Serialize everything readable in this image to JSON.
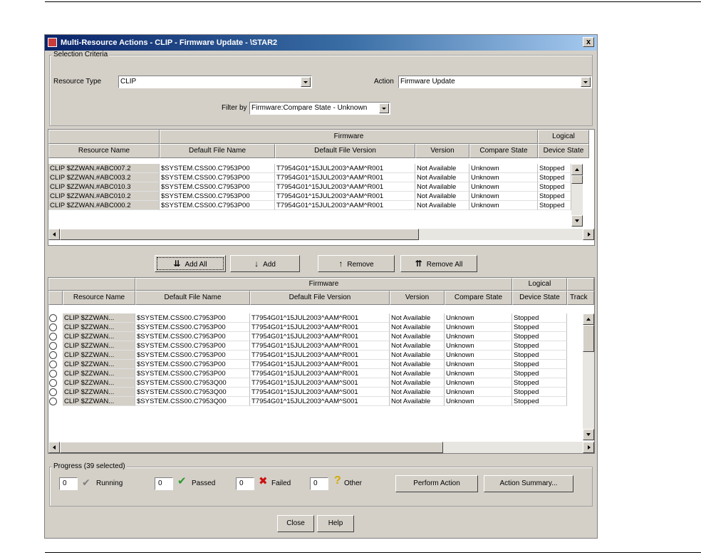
{
  "window": {
    "title": "Multi-Resource Actions - CLIP - Firmware Update - \\STAR2",
    "close_glyph": "x"
  },
  "selection": {
    "group_label": "Selection Criteria",
    "resource_type_label": "Resource Type",
    "resource_type_value": "CLIP",
    "action_label": "Action",
    "action_value": "Firmware Update",
    "filter_label": "Filter by",
    "filter_value": "Firmware:Compare State - Unknown"
  },
  "top_table": {
    "group_headers": [
      "Firmware",
      "Logical"
    ],
    "columns": [
      "Resource Name",
      "Default File Name",
      "Default File Version",
      "Version",
      "Compare State",
      "Device State"
    ],
    "rows": [
      [
        "CLIP $ZZWAN.#ABC007.2",
        "$SYSTEM.CSS00.C7953P00",
        "T7954G01^15JUL2003^AAM^R001",
        "Not Available",
        "Unknown",
        "Stopped"
      ],
      [
        "CLIP $ZZWAN.#ABC003.2",
        "$SYSTEM.CSS00.C7953P00",
        "T7954G01^15JUL2003^AAM^R001",
        "Not Available",
        "Unknown",
        "Stopped"
      ],
      [
        "CLIP $ZZWAN.#ABC010.3",
        "$SYSTEM.CSS00.C7953P00",
        "T7954G01^15JUL2003^AAM^R001",
        "Not Available",
        "Unknown",
        "Stopped"
      ],
      [
        "CLIP $ZZWAN.#ABC010.2",
        "$SYSTEM.CSS00.C7953P00",
        "T7954G01^15JUL2003^AAM^R001",
        "Not Available",
        "Unknown",
        "Stopped"
      ],
      [
        "CLIP $ZZWAN.#ABC000.2",
        "$SYSTEM.CSS00.C7953P00",
        "T7954G01^15JUL2003^AAM^R001",
        "Not Available",
        "Unknown",
        "Stopped"
      ]
    ]
  },
  "transfer_buttons": {
    "add_all": "Add All",
    "add": "Add",
    "remove": "Remove",
    "remove_all": "Remove All",
    "add_all_icon": "⇊",
    "add_icon": "↓",
    "remove_icon": "↑",
    "remove_all_icon": "⇈"
  },
  "bottom_table": {
    "group_headers": [
      "Firmware",
      "Logical"
    ],
    "columns": [
      "Resource Name",
      "Default File Name",
      "Default File Version",
      "Version",
      "Compare State",
      "Device State",
      "Track"
    ],
    "rows": [
      [
        "CLIP $ZZWAN...",
        "$SYSTEM.CSS00.C7953P00",
        "T7954G01^15JUL2003^AAM^R001",
        "Not Available",
        "Unknown",
        "Stopped"
      ],
      [
        "CLIP $ZZWAN...",
        "$SYSTEM.CSS00.C7953P00",
        "T7954G01^15JUL2003^AAM^R001",
        "Not Available",
        "Unknown",
        "Stopped"
      ],
      [
        "CLIP $ZZWAN...",
        "$SYSTEM.CSS00.C7953P00",
        "T7954G01^15JUL2003^AAM^R001",
        "Not Available",
        "Unknown",
        "Stopped"
      ],
      [
        "CLIP $ZZWAN...",
        "$SYSTEM.CSS00.C7953P00",
        "T7954G01^15JUL2003^AAM^R001",
        "Not Available",
        "Unknown",
        "Stopped"
      ],
      [
        "CLIP $ZZWAN...",
        "$SYSTEM.CSS00.C7953P00",
        "T7954G01^15JUL2003^AAM^R001",
        "Not Available",
        "Unknown",
        "Stopped"
      ],
      [
        "CLIP $ZZWAN...",
        "$SYSTEM.CSS00.C7953P00",
        "T7954G01^15JUL2003^AAM^R001",
        "Not Available",
        "Unknown",
        "Stopped"
      ],
      [
        "CLIP $ZZWAN...",
        "$SYSTEM.CSS00.C7953P00",
        "T7954G01^15JUL2003^AAM^R001",
        "Not Available",
        "Unknown",
        "Stopped"
      ],
      [
        "CLIP $ZZWAN...",
        "$SYSTEM.CSS00.C7953Q00",
        "T7954G01^15JUL2003^AAM^S001",
        "Not Available",
        "Unknown",
        "Stopped"
      ],
      [
        "CLIP $ZZWAN...",
        "$SYSTEM.CSS00.C7953Q00",
        "T7954G01^15JUL2003^AAM^S001",
        "Not Available",
        "Unknown",
        "Stopped"
      ],
      [
        "CLIP $ZZWAN...",
        "$SYSTEM.CSS00.C7953Q00",
        "T7954G01^15JUL2003^AAM^S001",
        "Not Available",
        "Unknown",
        "Stopped"
      ]
    ]
  },
  "progress": {
    "group_label": "Progress (39 selected)",
    "running_count": "0",
    "running_label": "Running",
    "running_icon": "✔",
    "passed_count": "0",
    "passed_label": "Passed",
    "passed_icon": "✔",
    "failed_count": "0",
    "failed_label": "Failed",
    "failed_icon": "✖",
    "other_count": "0",
    "other_label": "Other",
    "other_icon": "?",
    "perform_action": "Perform Action",
    "action_summary": "Action Summary..."
  },
  "footer": {
    "close": "Close",
    "help": "Help"
  },
  "colors": {
    "running": "#808080",
    "passed": "#2a9a2a",
    "failed": "#cc1111",
    "other": "#d4a800"
  }
}
